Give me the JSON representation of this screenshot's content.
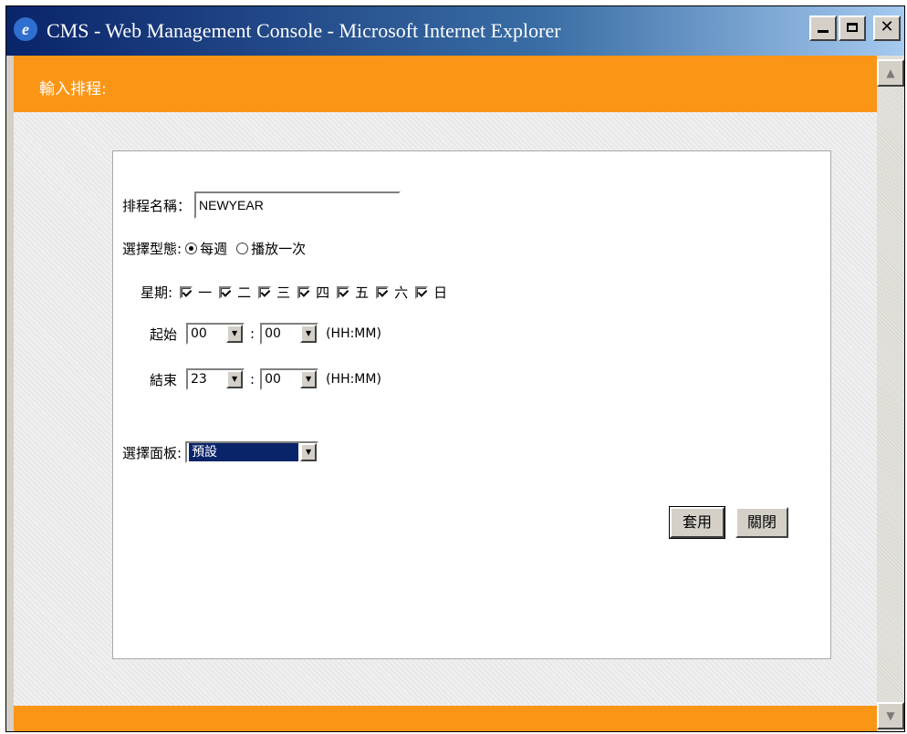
{
  "window": {
    "title": "CMS - Web Management Console - Microsoft Internet Explorer",
    "icon": "ie-icon",
    "controls": [
      "minimize-icon",
      "maximize-icon",
      "close-icon"
    ]
  },
  "header": {
    "label": "輸入排程:"
  },
  "form": {
    "name_label": "排程名稱：",
    "name_value": "NEWYEAR",
    "type_label": "選擇型態:",
    "type_options": [
      {
        "label": "每週",
        "selected": true
      },
      {
        "label": "播放一次",
        "selected": false
      }
    ],
    "weekday_label": "星期:",
    "weekdays": [
      {
        "label": "一",
        "checked": true
      },
      {
        "label": "二",
        "checked": true
      },
      {
        "label": "三",
        "checked": true
      },
      {
        "label": "四",
        "checked": true
      },
      {
        "label": "五",
        "checked": true
      },
      {
        "label": "六",
        "checked": true
      },
      {
        "label": "日",
        "checked": true
      }
    ],
    "start_label": "起始",
    "start_hour": "00",
    "start_minute": "00",
    "end_label": "結束",
    "end_hour": "23",
    "end_minute": "00",
    "colon": ":",
    "time_hint": "(HH:MM)",
    "panel_label": "選擇面板:",
    "panel_value": "預設"
  },
  "buttons": {
    "apply": "套用",
    "close": "關閉"
  },
  "colors": {
    "header": "#fb9515",
    "titlebar": "#0a246a",
    "selection": "#0a246a"
  }
}
